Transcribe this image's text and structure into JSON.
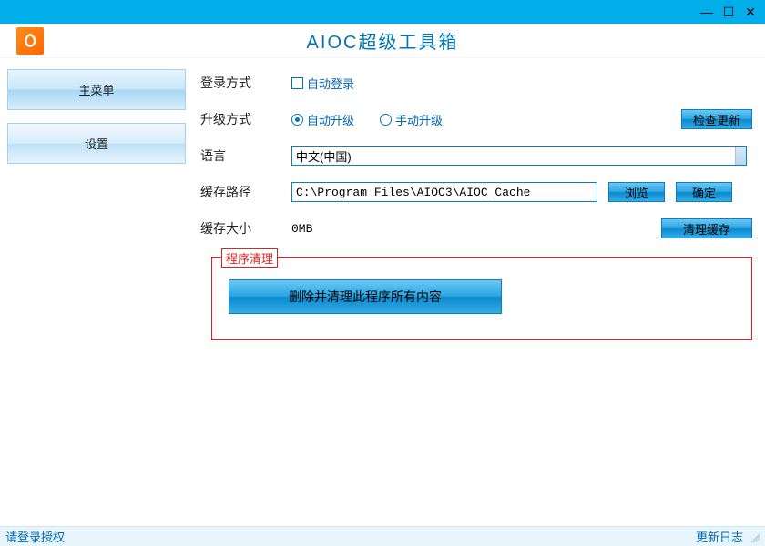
{
  "app_title": "AIOC超级工具箱",
  "sidebar": {
    "items": [
      {
        "label": "主菜单"
      },
      {
        "label": "设置"
      }
    ]
  },
  "settings": {
    "login_method_label": "登录方式",
    "auto_login_label": "自动登录",
    "upgrade_method_label": "升级方式",
    "auto_upgrade_label": "自动升级",
    "manual_upgrade_label": "手动升级",
    "check_update_btn": "检查更新",
    "language_label": "语言",
    "language_value": "中文(中国)",
    "cache_path_label": "缓存路径",
    "cache_path_value": "C:\\Program Files\\AIOC3\\AIOC_Cache",
    "browse_btn": "浏览",
    "confirm_btn": "确定",
    "cache_size_label": "缓存大小",
    "cache_size_value": "0MB",
    "clear_cache_btn": "清理缓存",
    "cleanup_group_title": "程序清理",
    "cleanup_btn": "删除并清理此程序所有内容"
  },
  "status": {
    "left": "请登录授权",
    "right": "更新日志"
  }
}
